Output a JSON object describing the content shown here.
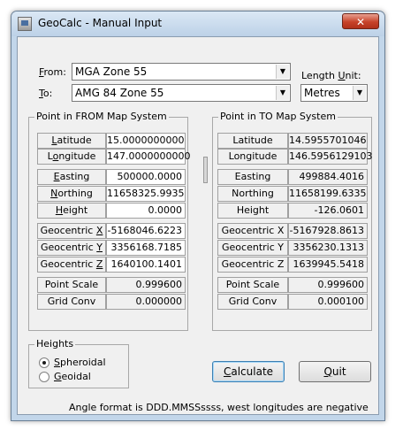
{
  "window": {
    "title": "GeoCalc - Manual Input",
    "close_glyph": "✕"
  },
  "from": {
    "label_prefix": "",
    "label_accel": "F",
    "label_rest": "rom:",
    "value": "MGA Zone 55"
  },
  "to": {
    "label_accel": "T",
    "label_rest": "o:",
    "value": "AMG 84 Zone 55"
  },
  "length_unit": {
    "label_pre": "Length ",
    "label_accel": "U",
    "label_rest": "nit:",
    "value": "Metres"
  },
  "from_group": {
    "title": "Point in FROM Map System",
    "rows": [
      {
        "label": "Latitude",
        "value": "15.0000000000"
      },
      {
        "label": "Longitude",
        "value": "147.0000000000"
      },
      {
        "label": "Easting",
        "value": "500000.0000"
      },
      {
        "label": "Northing",
        "value": "11658325.9935"
      },
      {
        "label": "Height",
        "value": "0.0000"
      },
      {
        "label": "Geocentric X",
        "value": "-5168046.6223"
      },
      {
        "label": "Geocentric Y",
        "value": "3356168.7185"
      },
      {
        "label": "Geocentric Z",
        "value": "1640100.1401"
      },
      {
        "label": "Point Scale",
        "value": "0.999600"
      },
      {
        "label": "Grid Conv",
        "value": "0.000000"
      }
    ]
  },
  "to_group": {
    "title": "Point in TO Map System",
    "rows": [
      {
        "label": "Latitude",
        "value": "14.5955701046"
      },
      {
        "label": "Longitude",
        "value": "146.5956129103"
      },
      {
        "label": "Easting",
        "value": "499884.4016"
      },
      {
        "label": "Northing",
        "value": "11658199.6335"
      },
      {
        "label": "Height",
        "value": "-126.0601"
      },
      {
        "label": "Geocentric X",
        "value": "-5167928.8613"
      },
      {
        "label": "Geocentric Y",
        "value": "3356230.1313"
      },
      {
        "label": "Geocentric Z",
        "value": "1639945.5418"
      },
      {
        "label": "Point Scale",
        "value": "0.999600"
      },
      {
        "label": "Grid Conv",
        "value": "0.000100"
      }
    ]
  },
  "heights": {
    "title": "Heights",
    "spheroidal": "Spheroidal",
    "geoidal": "Geoidal",
    "selected": "spheroidal"
  },
  "buttons": {
    "calculate": "Calculate",
    "quit": "Quit"
  },
  "footer_note": "Angle format is DDD.MMSSssss, west longitudes are negative"
}
